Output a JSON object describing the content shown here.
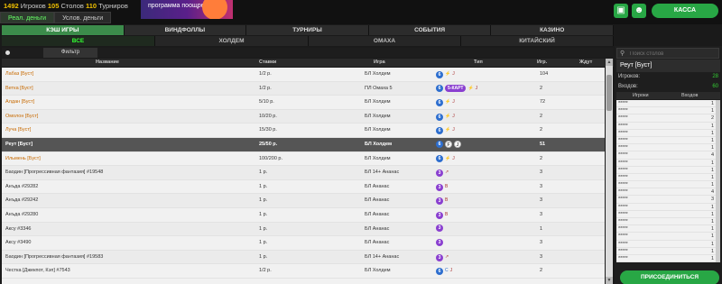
{
  "header": {
    "players_count": "1492",
    "players_label": "Игроков",
    "tables_count": "105",
    "tables_label": "Столов",
    "tourneys_count": "110",
    "tourneys_label": "Турниров",
    "money_tabs": [
      "Реал. деньги",
      "Услов. деньги"
    ],
    "promo_text": "программа поощрения",
    "kassa_label": "КАССА",
    "gift_icon": "gift-icon",
    "support_icon": "support-icon"
  },
  "main_tabs": [
    "КЭШ ИГРЫ",
    "ВИНДФОЛЛЫ",
    "ТУРНИРЫ",
    "СОБЫТИЯ",
    "КАЗИНО"
  ],
  "sub_tabs": [
    "ВСЕ",
    "ХОЛДЕМ",
    "ОМАХА",
    "КИТАЙСКИЙ"
  ],
  "filter_label": "Фильтр",
  "table": {
    "headers": {
      "name": "Название",
      "stakes": "Ставки",
      "game": "Игра",
      "type": "Тип",
      "players": "Игр.",
      "waiting": "Ждут"
    },
    "rows": [
      {
        "name": "Лабаз [Буст]",
        "stakes": "1/2 р.",
        "game": "БЛ Холдем",
        "players": "104",
        "orange": true,
        "badges": "6F J"
      },
      {
        "name": "Ветка [Буст]",
        "stakes": "1/2 р.",
        "game": "ПЛ Омаха 5",
        "players": "2",
        "orange": true,
        "badges": "6 5-КАРТ F J"
      },
      {
        "name": "Алдан [Буст]",
        "stakes": "5/10 р.",
        "game": "БЛ Холдем",
        "players": "72",
        "orange": true,
        "badges": "6F J"
      },
      {
        "name": "Омолон [Буст]",
        "stakes": "10/20 р.",
        "game": "БЛ Холдем",
        "players": "2",
        "orange": true,
        "badges": "6F J"
      },
      {
        "name": "Луча [Буст]",
        "stakes": "15/30 р.",
        "game": "БЛ Холдем",
        "players": "2",
        "orange": true,
        "badges": "6F J"
      },
      {
        "name": "Реут [Буст]",
        "stakes": "25/50 р.",
        "game": "БЛ Холдем",
        "players": "51",
        "orange": true,
        "selected": true,
        "badges": "6FJ"
      },
      {
        "name": "Ильмень [Буст]",
        "stakes": "100/200 р.",
        "game": "БЛ Холдем",
        "players": "2",
        "orange": true,
        "badges": "6F J"
      },
      {
        "name": "Баодин [Прогрессивная фантазия] #19548",
        "stakes": "1 р.",
        "game": "БЛ 14+ Ананас",
        "players": "3",
        "badges": "3P"
      },
      {
        "name": "Анъда #29282",
        "stakes": "1 р.",
        "game": "БЛ Ананас",
        "players": "3",
        "badges": "3B"
      },
      {
        "name": "Анъда #29242",
        "stakes": "1 р.",
        "game": "БЛ Ананас",
        "players": "3",
        "badges": "3B"
      },
      {
        "name": "Анъда #29280",
        "stakes": "1 р.",
        "game": "БЛ Ананас",
        "players": "3",
        "badges": "3B"
      },
      {
        "name": "Аксу #3346",
        "stakes": "1 р.",
        "game": "БЛ Ананас",
        "players": "1",
        "badges": "3"
      },
      {
        "name": "Аксу #3490",
        "stakes": "1 р.",
        "game": "БЛ Ананас",
        "players": "3",
        "badges": "3"
      },
      {
        "name": "Баодин [Прогрессивная фантазия] #19583",
        "stakes": "1 р.",
        "game": "БЛ 14+ Ананас",
        "players": "3",
        "badges": "3P"
      },
      {
        "name": "Честка [Джекпот, Кэп] #7543",
        "stakes": "1/2 р.",
        "game": "БЛ Холдем",
        "players": "2",
        "badges": "6C J"
      }
    ]
  },
  "right_panel": {
    "search_placeholder": "Поиск столов",
    "table_title": "Реут [Буст]",
    "players_label": "Игроков:",
    "players_value": "28",
    "entries_label": "Входов:",
    "entries_value": "60",
    "col_players": "Игроки",
    "col_entries": "Входов",
    "players": [
      {
        "name": "*****",
        "n": "1"
      },
      {
        "name": "*****",
        "n": "1"
      },
      {
        "name": "*****",
        "n": "2"
      },
      {
        "name": "*****",
        "n": "1"
      },
      {
        "name": "*****",
        "n": "1"
      },
      {
        "name": "*****",
        "n": "1"
      },
      {
        "name": "*****",
        "n": "1"
      },
      {
        "name": "*****",
        "n": "4"
      },
      {
        "name": "*****",
        "n": "1"
      },
      {
        "name": "*****",
        "n": "1"
      },
      {
        "name": "*****",
        "n": "1"
      },
      {
        "name": "*****",
        "n": "1"
      },
      {
        "name": "*****",
        "n": "4"
      },
      {
        "name": "*****",
        "n": "3"
      },
      {
        "name": "*****",
        "n": "1"
      },
      {
        "name": "*****",
        "n": "1"
      },
      {
        "name": "*****",
        "n": "1"
      },
      {
        "name": "*****",
        "n": "1"
      },
      {
        "name": "*****",
        "n": "1"
      },
      {
        "name": "*****",
        "n": "1"
      },
      {
        "name": "*****",
        "n": "1"
      },
      {
        "name": "*****",
        "n": "1"
      }
    ],
    "join_label": "ПРИСОЕДИНИТЬСЯ"
  }
}
